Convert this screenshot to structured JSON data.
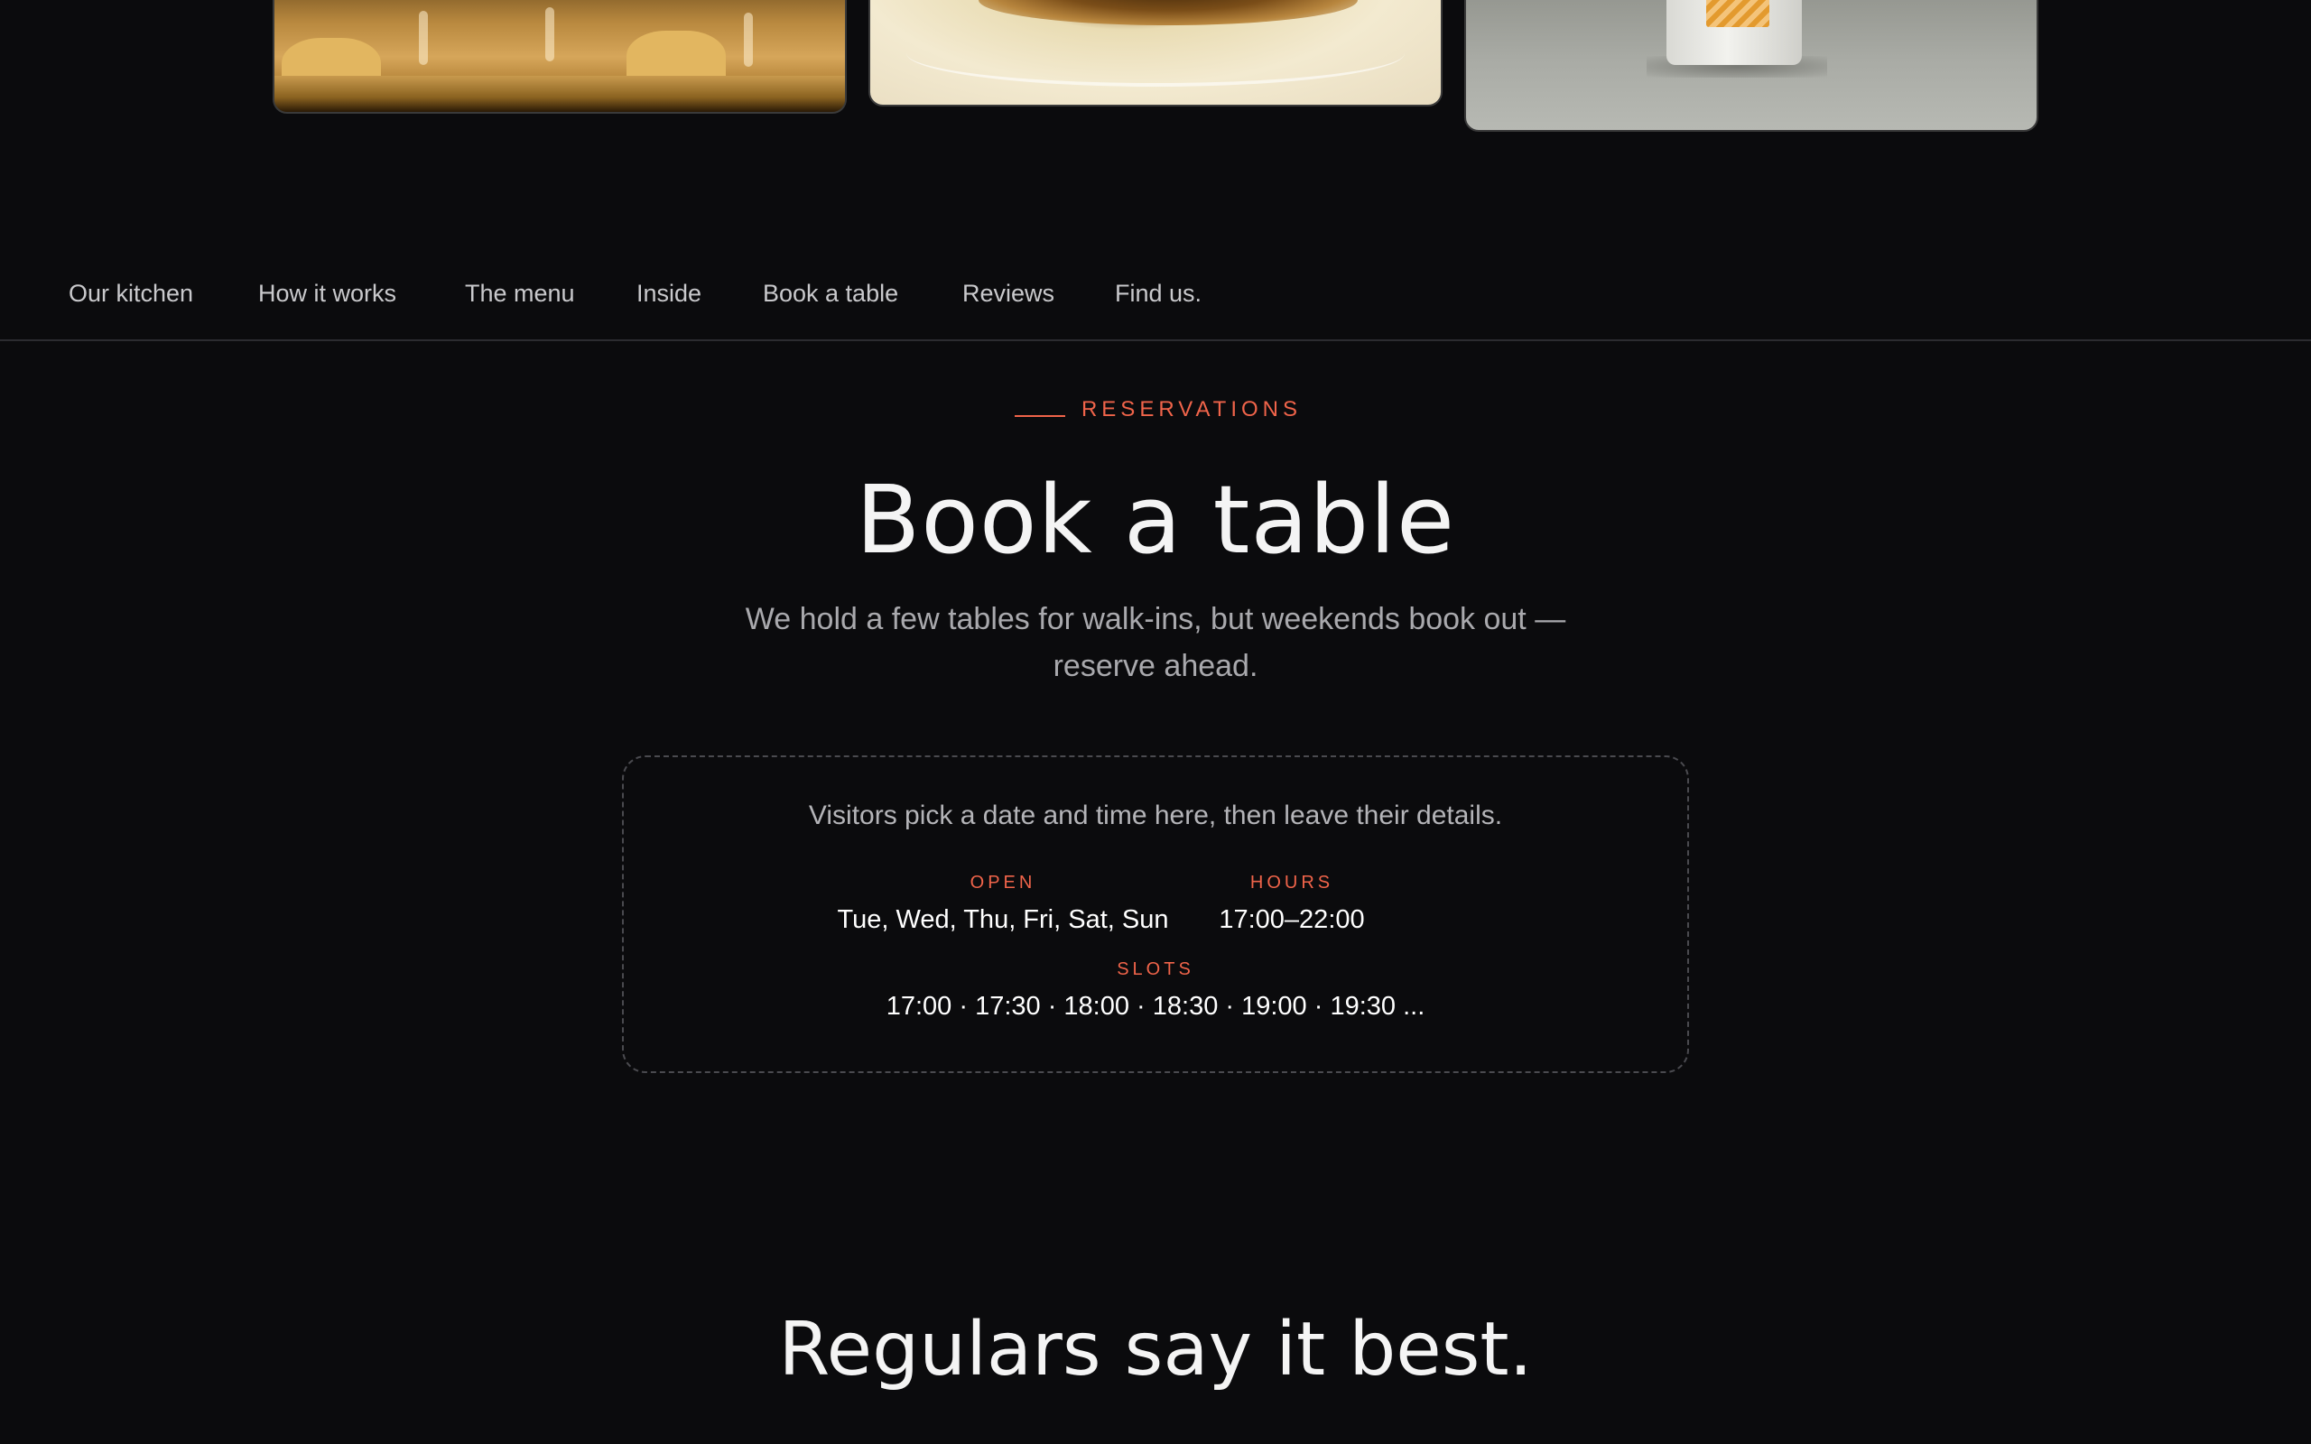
{
  "nav": {
    "items": [
      {
        "label": "Our kitchen"
      },
      {
        "label": "How it works"
      },
      {
        "label": "The menu"
      },
      {
        "label": "Inside"
      },
      {
        "label": "Book a table"
      },
      {
        "label": "Reviews"
      },
      {
        "label": "Find us."
      }
    ]
  },
  "reservations": {
    "eyebrow": "RESERVATIONS",
    "title": "Book a table",
    "subtitle": "We hold a few tables for walk-ins, but weekends book out — reserve ahead.",
    "panel": {
      "intro": "Visitors pick a date and time here, then leave their details.",
      "open_label": "OPEN",
      "open_value": "Tue, Wed, Thu, Fri, Sat, Sun",
      "hours_label": "HOURS",
      "hours_value": "17:00–22:00",
      "slots_label": "SLOTS",
      "slots_value": "17:00 · 17:30 · 18:00 · 18:30 · 19:00 · 19:30 ..."
    }
  },
  "reviews": {
    "heading": "Regulars say it best."
  },
  "colors": {
    "background": "#0b0b0d",
    "accent": "#f0644a"
  }
}
